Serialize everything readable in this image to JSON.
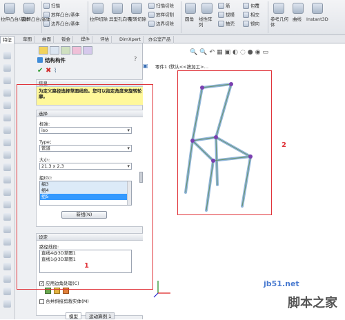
{
  "toolbar": {
    "group1": [
      "拉伸凸台/基体",
      "旋转凸台/基体"
    ],
    "group2": [
      "扫描",
      "放样凸台/基体",
      "边界凸台/基体"
    ],
    "group3": [
      "拉伸切除",
      "异型孔向导",
      "旋转切除"
    ],
    "group4": [
      "扫描切除",
      "放样切割",
      "边界切除"
    ],
    "group5": [
      "圆角",
      "线性阵列",
      "筋",
      "拔模",
      "抽壳",
      "包覆",
      "相交",
      "镜向",
      "参考几何体",
      "曲线",
      "Instant3D"
    ]
  },
  "tabs": [
    "特征",
    "草图",
    "曲面",
    "钣金",
    "焊件",
    "评估",
    "DimXpert",
    "办公室产品"
  ],
  "feature": {
    "title": "结构构件",
    "help_title": "信息",
    "help_text": "为定义路径选择草图线段。您可以指定角度来旋转轮廓。",
    "selection_header": "选择",
    "standard_label": "标准:",
    "standard_value": "iso",
    "type_label": "Type：",
    "type_value": "管道",
    "size_label": "大小:",
    "size_value": "21.3 x 2.3",
    "groups_label": "组(G):",
    "groups": [
      "组3",
      "组4",
      "组5"
    ],
    "new_group_button": "新组(N)",
    "settings_header": "设定",
    "path_label": "路径线段:",
    "paths": [
      "直线4@3D草图1",
      "直线1@3D草图1"
    ],
    "corner_checkbox": "应用边角处理(C)",
    "merge_checkbox": "合并斜接剪裁实体(M)"
  },
  "tree": {
    "part": "零件1 (默认<<按加工>…"
  },
  "bottom_tabs": [
    "模型",
    "运动算例 1"
  ],
  "annotations": {
    "label1": "1",
    "label2": "2"
  },
  "watermark": {
    "site": "jb51.net",
    "name": "脚本之家"
  }
}
